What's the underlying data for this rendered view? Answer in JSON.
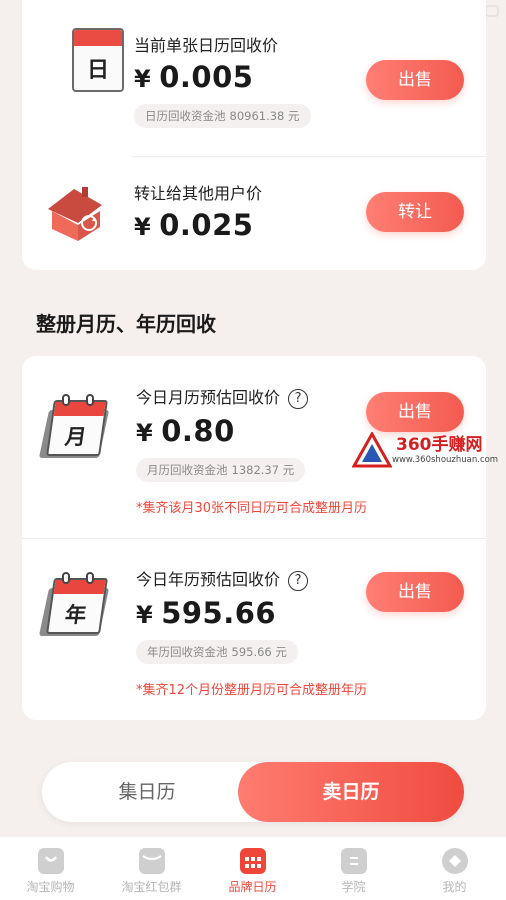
{
  "single": {
    "title": "当前单张日历回收价",
    "currency": "¥",
    "price": "0.005",
    "pool_label": "日历回收资金池",
    "pool_amount": "80961.38 元",
    "button": "出售",
    "icon_char": "日"
  },
  "transfer": {
    "title": "转让给其他用户价",
    "currency": "¥",
    "price": "0.025",
    "button": "转让"
  },
  "section_title": "整册月历、年历回收",
  "monthly": {
    "title": "今日月历预估回收价",
    "help": "?",
    "currency": "¥",
    "price": "0.80",
    "pool_label": "月历回收资金池",
    "pool_amount": "1382.37 元",
    "note": "*集齐该月30张不同日历可合成整册月历",
    "button": "出售",
    "icon_char": "月"
  },
  "yearly": {
    "title": "今日年历预估回收价",
    "help": "?",
    "currency": "¥",
    "price": "595.66",
    "pool_label": "年历回收资金池",
    "pool_amount": "595.66 元",
    "note": "*集齐12个月份整册月历可合成整册年历",
    "button": "出售",
    "icon_char": "年"
  },
  "segment": {
    "left": "集日历",
    "right": "卖日历"
  },
  "watermark": {
    "title": "360手赚网",
    "url": "www.360shouzhuan.com"
  },
  "tabs": [
    {
      "label": "淘宝购物",
      "icon": "shopping-bag-icon"
    },
    {
      "label": "淘宝红包群",
      "icon": "red-packet-icon"
    },
    {
      "label": "品牌日历",
      "icon": "calendar-icon",
      "active": true
    },
    {
      "label": "学院",
      "icon": "book-icon"
    },
    {
      "label": "我的",
      "icon": "profile-icon"
    }
  ],
  "colors": {
    "accent": "#f35b50",
    "note": "#f0463a",
    "background": "#f5efed"
  }
}
